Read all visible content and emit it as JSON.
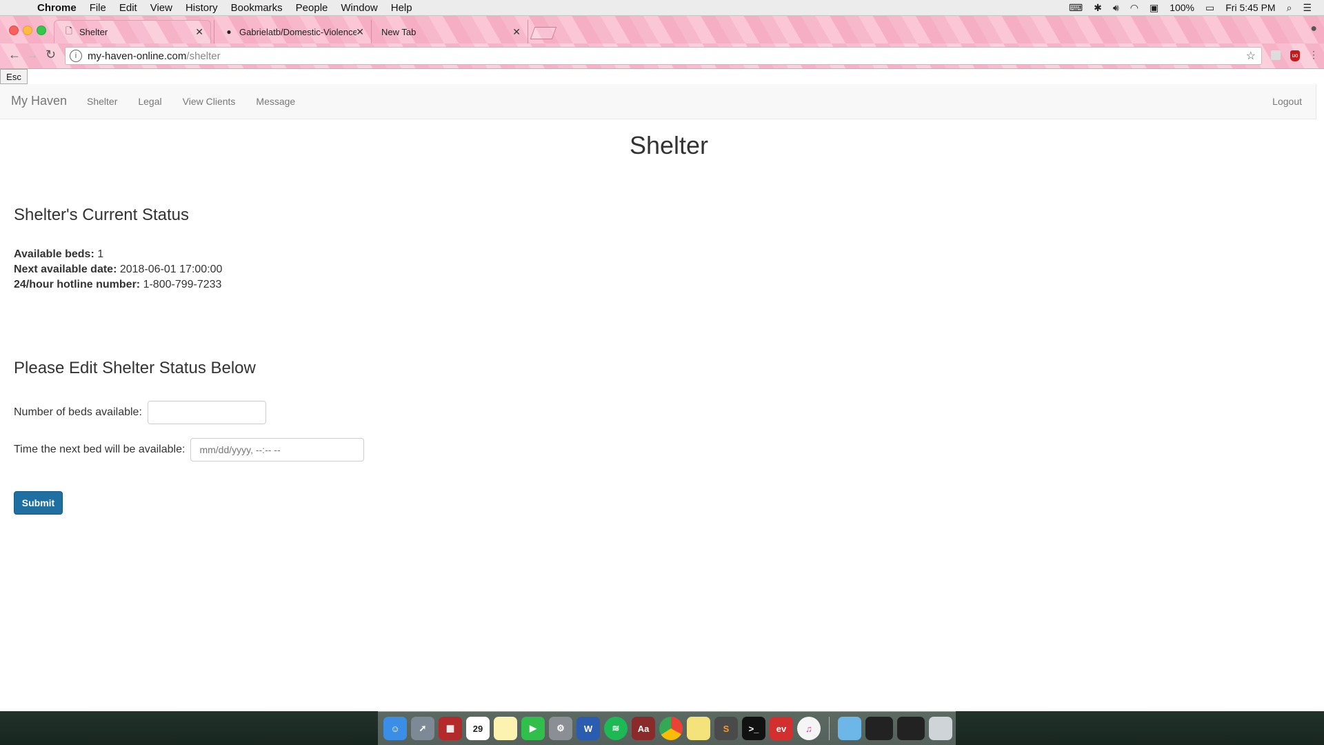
{
  "menubar": {
    "app": "Chrome",
    "items": [
      "File",
      "Edit",
      "View",
      "History",
      "Bookmarks",
      "People",
      "Window",
      "Help"
    ],
    "battery": "100%",
    "clock": "Fri 5:45 PM"
  },
  "browser": {
    "tabs": [
      {
        "title": "Shelter",
        "icon": "page-icon"
      },
      {
        "title": "Gabrielatb/Domestic-Violence-",
        "icon": "github-icon"
      },
      {
        "title": "New Tab",
        "icon": ""
      }
    ],
    "url_host": "my-haven-online.com",
    "url_path": "/shelter"
  },
  "page": {
    "esc_label": "Esc",
    "brand": "My Haven",
    "nav": [
      "Shelter",
      "Legal",
      "View Clients",
      "Message"
    ],
    "logout": "Logout",
    "title": "Shelter",
    "status_heading": "Shelter's Current Status",
    "status": {
      "beds_label": "Available beds:",
      "beds_value": "1",
      "next_label": "Next available date:",
      "next_value": "2018-06-01 17:00:00",
      "hotline_label": "24/hour hotline number:",
      "hotline_value": "1-800-799-7233"
    },
    "edit_heading": "Please Edit Shelter Status Below",
    "form": {
      "beds_label": "Number of beds available:",
      "beds_value": "",
      "time_label": "Time the next bed will be available:",
      "time_placeholder": "mm/dd/yyyy, --:-- --",
      "submit": "Submit"
    }
  },
  "dock": {
    "icons": [
      "finder-icon",
      "launchpad-icon",
      "photo-booth-icon",
      "calendar-icon",
      "notes-icon",
      "facetime-icon",
      "system-preferences-icon",
      "word-icon",
      "spotify-icon",
      "dictionary-icon",
      "chrome-icon",
      "stickies-icon",
      "sublime-icon",
      "terminal-icon",
      "evernote-icon",
      "itunes-icon",
      "folder-icon",
      "window-icon",
      "window-icon",
      "trash-icon"
    ],
    "calendar_day": "29"
  }
}
